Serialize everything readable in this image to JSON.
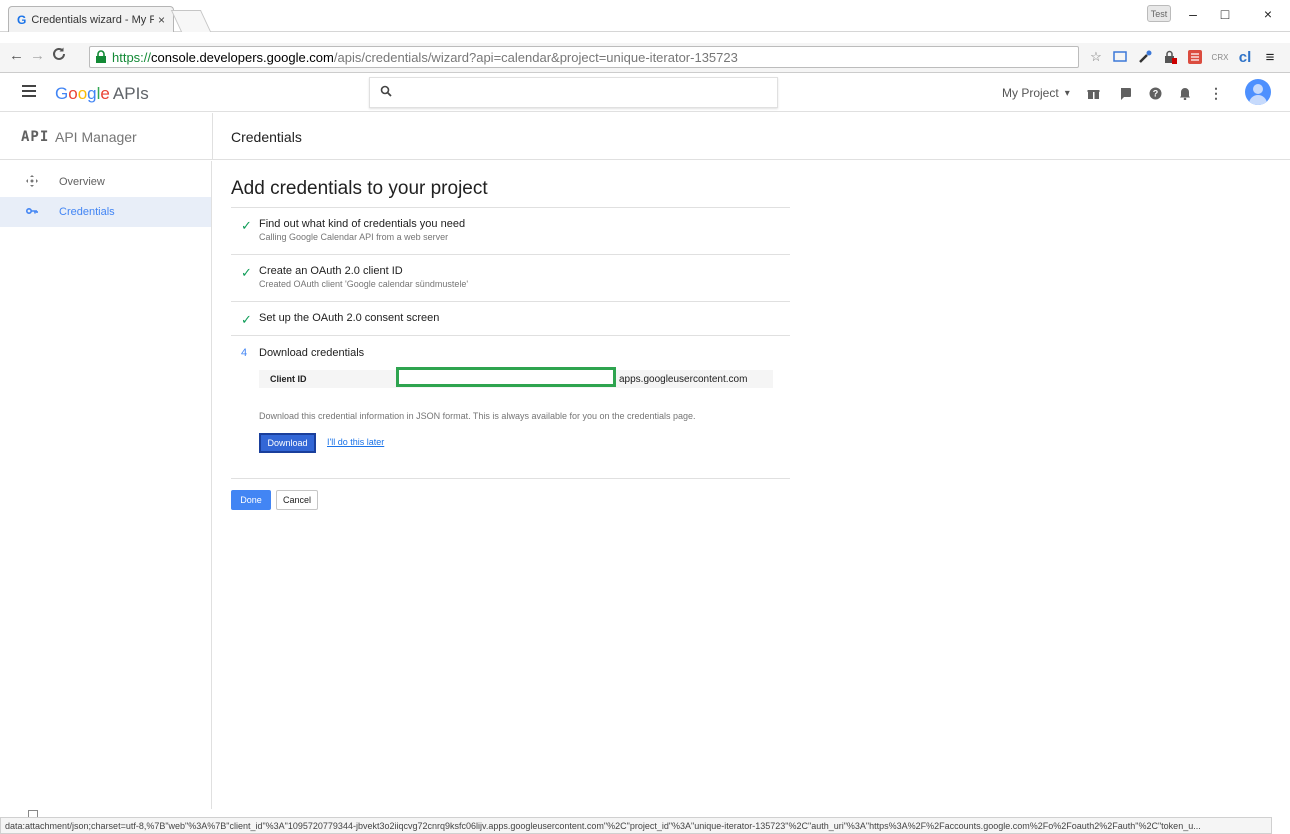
{
  "browser": {
    "tab_title": "Credentials wizard - My P",
    "tab_favicon": "G",
    "tab_close": "×",
    "profile_badge": "Test",
    "window_minimize": "–",
    "window_maximize": "□",
    "window_close": "×",
    "url_scheme": "https://",
    "url_host": "console.developers.google.com",
    "url_path": "/apis/credentials/wizard?api=calendar&project=unique-iterator-135723"
  },
  "header": {
    "brand_google": [
      "G",
      "o",
      "o",
      "g",
      "l",
      "e"
    ],
    "brand_apis": "APIs",
    "search_placeholder": "",
    "project_name": "My Project",
    "project_caret": "▾"
  },
  "subheader": {
    "api_logo": "API",
    "api_title": "API Manager",
    "page_title": "Credentials"
  },
  "sidebar": {
    "items": [
      {
        "label": "Overview",
        "icon": "overview-icon",
        "active": false
      },
      {
        "label": "Credentials",
        "icon": "key-icon",
        "active": true
      }
    ]
  },
  "wizard": {
    "title": "Add credentials to your project",
    "steps": [
      {
        "title": "Find out what kind of credentials you need",
        "subtitle": "Calling Google Calendar API from a web server",
        "done": true
      },
      {
        "title": "Create an OAuth 2.0 client ID",
        "subtitle": "Created OAuth client 'Google calendar sündmustele'",
        "done": true
      },
      {
        "title": "Set up the OAuth 2.0 consent screen",
        "subtitle": "",
        "done": true
      },
      {
        "number": "4",
        "title": "Download credentials",
        "done": false
      }
    ],
    "client_id_label": "Client ID",
    "client_id_suffix": "apps.googleusercontent.com",
    "download_note": "Download this credential information in JSON format. This is always available for you on the credentials page.",
    "download_button": "Download",
    "later_link": "I'll do this later",
    "done_button": "Done",
    "cancel_button": "Cancel"
  },
  "statusbar": {
    "text": "data:attachment/json;charset=utf-8,%7B\"web\"%3A%7B\"client_id\"%3A\"1095720779344-jbvekt3o2iiqcvg72cnrq9ksfc06lijv.apps.googleusercontent.com\"%2C\"project_id\"%3A\"unique-iterator-135723\"%2C\"auth_uri\"%3A\"https%3A%2F%2Faccounts.google.com%2Fo%2Foauth2%2Fauth\"%2C\"token_u..."
  },
  "colors": {
    "accent": "#4285f4",
    "check": "#0f9d58",
    "highlight_box": "#2ea44f",
    "active_nav_bg": "#e8eef8"
  }
}
